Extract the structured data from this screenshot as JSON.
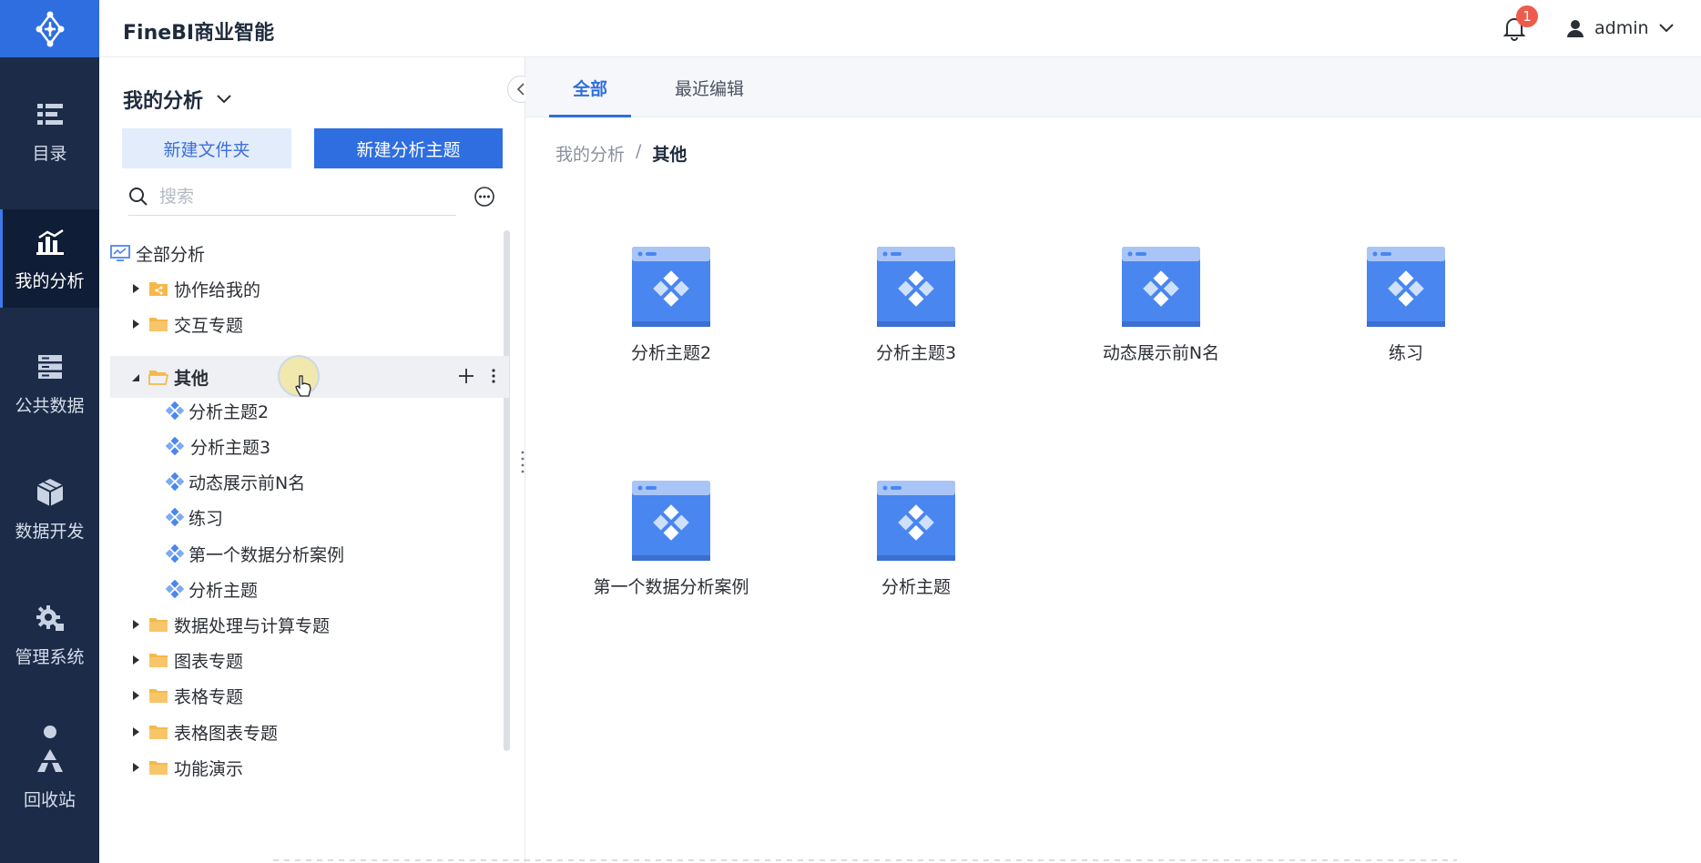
{
  "header": {
    "app_title": "FineBI商业智能",
    "notification_count": "1",
    "user_name": "admin"
  },
  "rail": {
    "items": [
      {
        "label": "目录",
        "icon": "catalog-icon"
      },
      {
        "label": "我的分析",
        "icon": "chart-icon",
        "active": true
      },
      {
        "label": "公共数据",
        "icon": "database-icon"
      },
      {
        "label": "数据开发",
        "icon": "cube-icon"
      },
      {
        "label": "管理系统",
        "icon": "gear-icon"
      },
      {
        "label": "回收站",
        "icon": "recycle-icon"
      }
    ]
  },
  "panel": {
    "title": "我的分析",
    "new_folder_label": "新建文件夹",
    "new_subject_label": "新建分析主题",
    "search_placeholder": "搜索",
    "tree": [
      {
        "label": "全部分析",
        "type": "root"
      },
      {
        "label": "协作给我的",
        "type": "folder-shared",
        "expanded": false
      },
      {
        "label": "交互专题",
        "type": "folder",
        "expanded": false
      },
      {
        "label": "其他",
        "type": "folder",
        "expanded": true,
        "selected": true
      },
      {
        "label": "分析主题2",
        "type": "subject"
      },
      {
        "label": "分析主题3",
        "type": "subject"
      },
      {
        "label": "动态展示前N名",
        "type": "subject"
      },
      {
        "label": "练习",
        "type": "subject"
      },
      {
        "label": "第一个数据分析案例",
        "type": "subject"
      },
      {
        "label": "分析主题",
        "type": "subject"
      },
      {
        "label": "数据处理与计算专题",
        "type": "folder",
        "expanded": false
      },
      {
        "label": "图表专题",
        "type": "folder",
        "expanded": false
      },
      {
        "label": "表格专题",
        "type": "folder",
        "expanded": false
      },
      {
        "label": "表格图表专题",
        "type": "folder",
        "expanded": false
      },
      {
        "label": "功能演示",
        "type": "folder",
        "expanded": false
      }
    ]
  },
  "main": {
    "tabs": [
      {
        "label": "全部",
        "active": true
      },
      {
        "label": "最近编辑",
        "active": false
      }
    ],
    "breadcrumb": {
      "root": "我的分析",
      "separator": "/",
      "current": "其他"
    },
    "cards": [
      {
        "label": "分析主题2"
      },
      {
        "label": "分析主题3"
      },
      {
        "label": "动态展示前N名"
      },
      {
        "label": "练习"
      },
      {
        "label": "第一个数据分析案例"
      },
      {
        "label": "分析主题"
      }
    ]
  },
  "colors": {
    "brand_blue": "#2f6ee0",
    "rail_bg": "#1c2b48",
    "folder_yellow": "#f5b94a",
    "subject_blue": "#4a86f0"
  }
}
